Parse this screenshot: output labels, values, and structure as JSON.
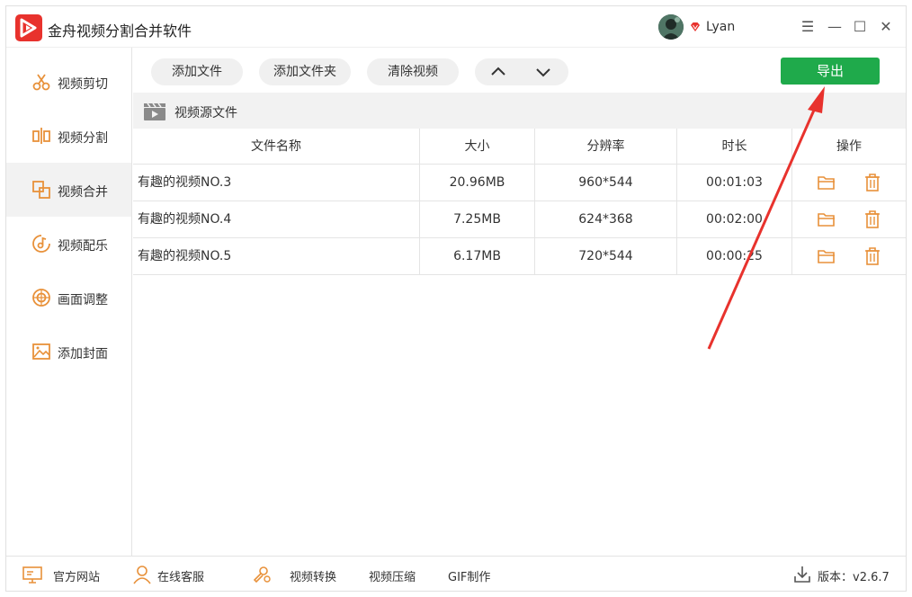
{
  "app": {
    "title": "金舟视频分割合并软件",
    "user_name": "Lyan"
  },
  "window_controls": {
    "menu": "☰",
    "minimize": "—",
    "maximize": "☐",
    "close": "✕"
  },
  "sidebar": {
    "items": [
      {
        "label": "视频剪切",
        "icon": "scissors-icon"
      },
      {
        "label": "视频分割",
        "icon": "split-icon"
      },
      {
        "label": "视频合并",
        "icon": "merge-icon",
        "active": true
      },
      {
        "label": "视频配乐",
        "icon": "music-icon"
      },
      {
        "label": "画面调整",
        "icon": "adjust-icon"
      },
      {
        "label": "添加封面",
        "icon": "image-icon"
      }
    ]
  },
  "toolbar": {
    "add_file": "添加文件",
    "add_folder": "添加文件夹",
    "clear": "清除视频",
    "export": "导出"
  },
  "source": {
    "title": "视频源文件"
  },
  "table": {
    "headers": {
      "name": "文件名称",
      "size": "大小",
      "resolution": "分辨率",
      "duration": "时长",
      "actions": "操作"
    },
    "rows": [
      {
        "name": "有趣的视频NO.3",
        "size": "20.96MB",
        "resolution": "960*544",
        "duration": "00:01:03"
      },
      {
        "name": "有趣的视频NO.4",
        "size": "7.25MB",
        "resolution": "624*368",
        "duration": "00:02:00"
      },
      {
        "name": "有趣的视频NO.5",
        "size": "6.17MB",
        "resolution": "720*544",
        "duration": "00:00:25"
      }
    ]
  },
  "footer": {
    "website": "官方网站",
    "support": "在线客服",
    "convert": "视频转换",
    "compress": "视频压缩",
    "gif": "GIF制作",
    "version": "版本：v2.6.7"
  },
  "colors": {
    "accent_orange": "#e8913a",
    "export_green": "#1faa4b",
    "brand_red": "#e8322d",
    "annotation_red": "#e8322d"
  }
}
